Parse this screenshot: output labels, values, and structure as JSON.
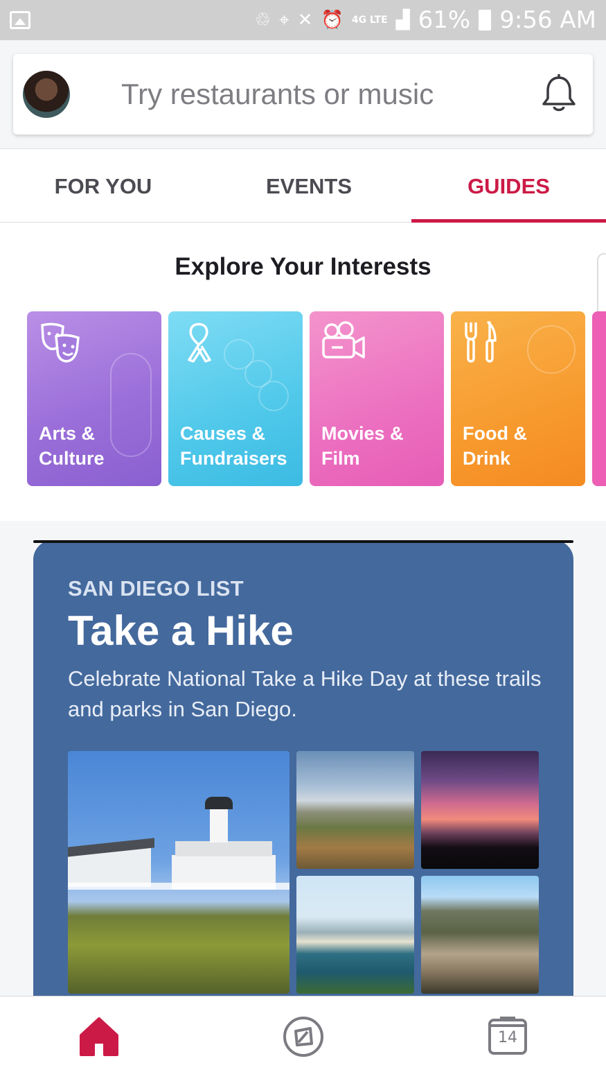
{
  "status_bar": {
    "battery": "61%",
    "time": "9:56 AM",
    "network": "4G LTE"
  },
  "search": {
    "placeholder": "Try restaurants or music"
  },
  "tabs": [
    {
      "label": "FOR YOU",
      "active": false
    },
    {
      "label": "EVENTS",
      "active": false
    },
    {
      "label": "GUIDES",
      "active": true
    }
  ],
  "explore": {
    "title": "Explore Your Interests",
    "categories": [
      {
        "label": "Arts &\nCulture",
        "icon": "theater-masks-icon",
        "color": "#9b6fd9"
      },
      {
        "label": "Causes &\nFundraisers",
        "icon": "ribbon-icon",
        "color": "#4fc8ea"
      },
      {
        "label": "Movies &\nFilm",
        "icon": "video-camera-icon",
        "color": "#ec6fc0"
      },
      {
        "label": "Food &\nDrink",
        "icon": "fork-knife-icon",
        "color": "#f79a2e"
      }
    ]
  },
  "guide": {
    "kicker": "SAN DIEGO LIST",
    "title": "Take a Hike",
    "description": "Celebrate National Take a Hike Day at these trails and parks in San Diego."
  },
  "bottom_nav": [
    {
      "name": "home",
      "icon": "home-icon",
      "active": true
    },
    {
      "name": "discover",
      "icon": "compass-icon",
      "active": false
    },
    {
      "name": "calendar",
      "icon": "calendar-icon",
      "label": "14",
      "active": false
    }
  ],
  "colors": {
    "accent": "#cc1a46",
    "guide_card": "#44699d"
  }
}
